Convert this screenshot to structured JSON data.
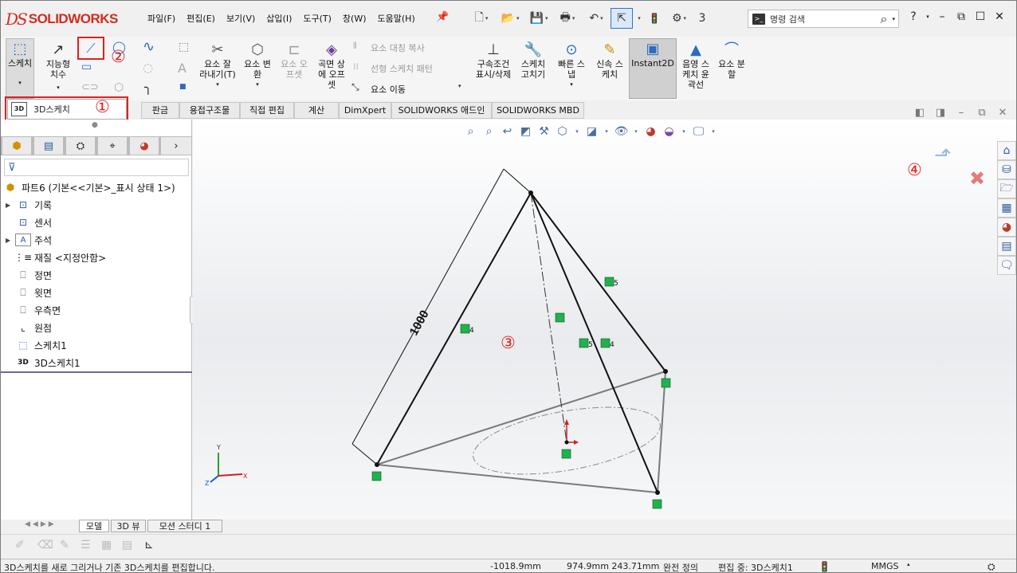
{
  "app": {
    "brand": "SOLIDWORKS"
  },
  "menu": [
    "파일(F)",
    "편집(E)",
    "보기(V)",
    "삽입(I)",
    "도구(T)",
    "창(W)",
    "도움말(H)"
  ],
  "qat": {
    "more": "3",
    "search_placeholder": "명령 검색",
    "help": "?"
  },
  "ribbon": {
    "sketch": "스케치",
    "smart_dim": [
      "지능형",
      "치수"
    ],
    "trim": [
      "요소 잘",
      "라내기(T)"
    ],
    "convert": [
      "요소 변",
      "환"
    ],
    "offset": [
      "요소 오",
      "프셋"
    ],
    "surface_offset": [
      "곡면 상",
      "에 오프",
      "셋"
    ],
    "mirror": "요소 대칭 복사",
    "linear_pattern": "선형 스케치 패턴",
    "move": "요소 이동",
    "relations": [
      "구속조건",
      "표시/삭제"
    ],
    "repair": [
      "스케치",
      "고치기"
    ],
    "quick_snap": [
      "빠른 스",
      "냅"
    ],
    "rapid_sketch": [
      "신속 스",
      "케치"
    ],
    "instant2d": "Instant2D",
    "shaded": [
      "음영 스",
      "케치 윤",
      "곽선"
    ],
    "split": [
      "요소 분",
      "할"
    ]
  },
  "annotations": {
    "n1": "①",
    "n2": "②",
    "n3": "③",
    "n4": "④"
  },
  "active_tab": "3D스케치",
  "cmd_tabs": [
    "판금",
    "용접구조물",
    "직접 편집",
    "계산",
    "DimXpert",
    "SOLIDWORKS 애드인",
    "SOLIDWORKS MBD"
  ],
  "tree": {
    "root": "파트6  (기본<<기본>_표시 상태 1>)",
    "items": [
      "기록",
      "센서",
      "주석",
      "재질 <지정안함>",
      "정면",
      "윗면",
      "우측면",
      "원점",
      "스케치1",
      "3D스케치1"
    ]
  },
  "drawing": {
    "dimension": "1000",
    "rel_a": "5",
    "rel_b": "4",
    "rel_c": "5",
    "rel_d": "4"
  },
  "triad": {
    "x": "X",
    "y": "Y",
    "z": "Z"
  },
  "bottom_tabs": [
    "모델",
    "3D 뷰",
    "모션 스터디 1"
  ],
  "status": {
    "message": "3D스케치를 새로 그리거나 기존 3D스케치를 편집합니다.",
    "coord1": "-1018.9mm",
    "coord2": "974.9mm 243.71mm",
    "defined": "완전 정의",
    "editing": "편집 중: 3D스케치1",
    "units": "MMGS"
  },
  "colors": {
    "accent_red": "#e02020",
    "relation_green": "#22b14c",
    "sketch_black": "#111111",
    "brand_red": "#d52b1e"
  }
}
